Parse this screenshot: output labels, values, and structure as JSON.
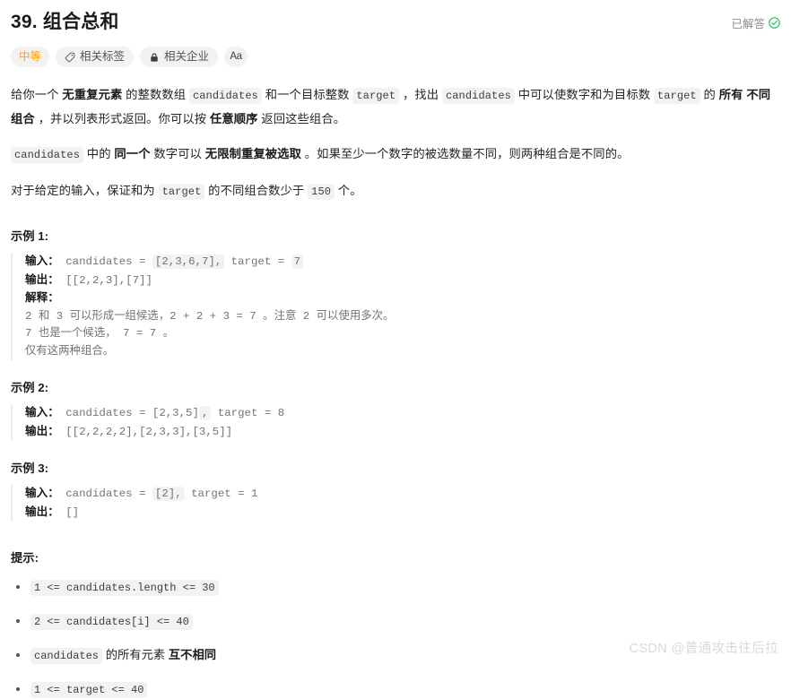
{
  "header": {
    "title": "39. 组合总和",
    "solved_label": "已解答",
    "solved_icon": "check-circle-icon",
    "solved_color": "#2db55d"
  },
  "tags": {
    "difficulty": {
      "label": "中等",
      "color": "#ffa116"
    },
    "items": [
      {
        "label": "相关标签",
        "icon": "tag-icon"
      },
      {
        "label": "相关企业",
        "icon": "lock-icon"
      }
    ],
    "font_toggle": {
      "label": "Aa",
      "icon": "font-size-icon"
    }
  },
  "description": {
    "p1": {
      "s1": "给你一个 ",
      "b1": "无重复元素",
      "s2": " 的整数数组 ",
      "c1": "candidates",
      "s3": " 和一个目标整数 ",
      "c2": "target",
      "s4": " ，找出 ",
      "c3": "candidates",
      "s5": " 中可以使数字和为目标数 ",
      "c4": "target",
      "s6": " 的 ",
      "b2": "所有",
      "s7": " ",
      "b3": "不同组合",
      "s8": " ，并以列表形式返回。你可以按 ",
      "b4": "任意顺序",
      "s9": " 返回这些组合。"
    },
    "p2": {
      "c1": "candidates",
      "s1": " 中的 ",
      "b1": "同一个",
      "s2": " 数字可以 ",
      "b2": "无限制重复被选取",
      "s3": " 。如果至少一个数字的被选数量不同，则两种组合是不同的。"
    },
    "p3": {
      "s1": "对于给定的输入，保证和为 ",
      "c1": "target",
      "s2": " 的不同组合数少于 ",
      "c2": "150",
      "s3": " 个。"
    }
  },
  "examples": [
    {
      "title": "示例 1:",
      "input_label": "输入：",
      "input_prefix": " candidates = ",
      "input_hl1": "[2,3,6,7],",
      "input_mid": " target = ",
      "input_hl2": "7",
      "output_label": "输出：",
      "output_value": " [[2,2,3],[7]]",
      "explain_label": "解释：",
      "explain_lines": [
        "2 和 3 可以形成一组候选，2 + 2 + 3 = 7 。注意 2 可以使用多次。",
        "7 也是一个候选， 7 = 7 。",
        "仅有这两种组合。"
      ]
    },
    {
      "title": "示例 2:",
      "input_label": "输入：",
      "input_prefix": " candidates = [2,3,5]",
      "input_hl1": ",",
      "input_mid": " target = 8",
      "input_hl2": "",
      "output_label": "输出：",
      "output_value": " [[2,2,2,2],[2,3,3],[3,5]]",
      "explain_label": "",
      "explain_lines": []
    },
    {
      "title": "示例 3:",
      "input_label": "输入：",
      "input_prefix": " candidates = ",
      "input_hl1": "[2],",
      "input_mid": " target = 1",
      "input_hl2": "",
      "output_label": "输出：",
      "output_value": " []",
      "explain_label": "",
      "explain_lines": []
    }
  ],
  "hints": {
    "title": "提示:",
    "items": [
      {
        "type": "code",
        "code": "1 <= candidates.length <= 30"
      },
      {
        "type": "code",
        "code": "2 <= candidates[i] <= 40"
      },
      {
        "type": "mixed",
        "code": "candidates",
        "text": " 的所有元素 ",
        "bold": "互不相同"
      },
      {
        "type": "code",
        "code": "1 <= target <= 40"
      }
    ]
  },
  "watermark": "CSDN @普通攻击往后拉"
}
